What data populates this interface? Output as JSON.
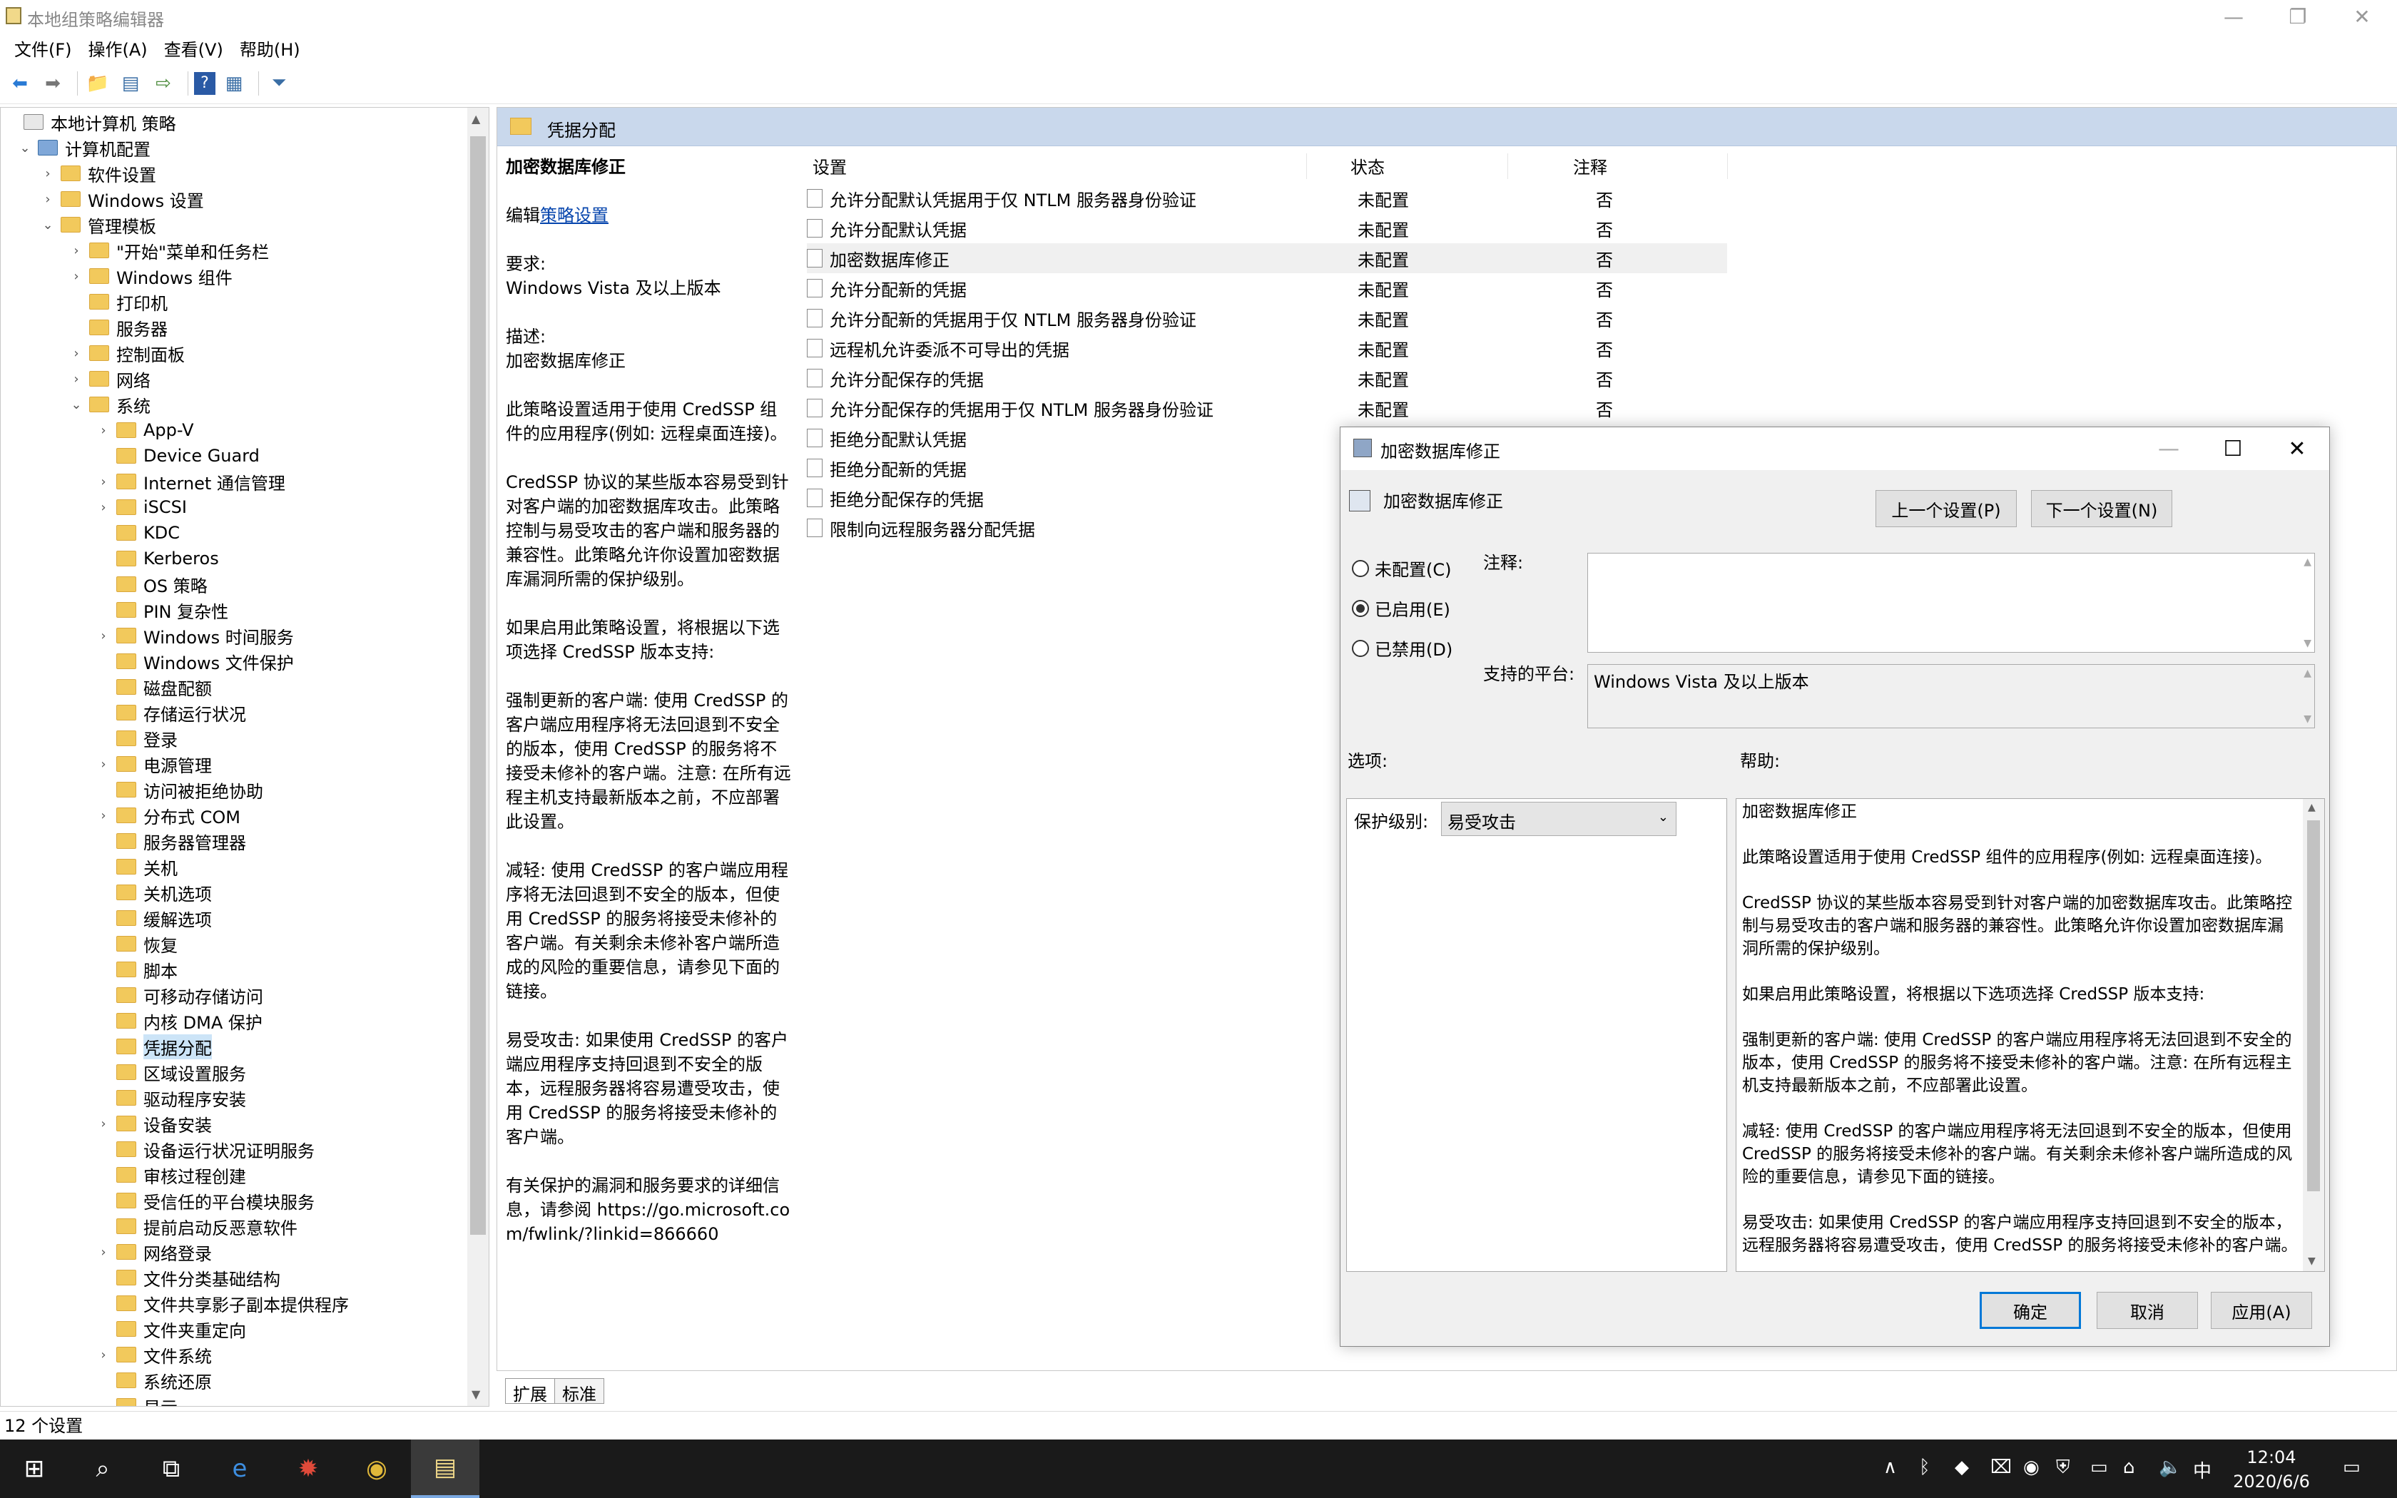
{
  "window": {
    "title": "本地组策略编辑器"
  },
  "menu": [
    "文件(F)",
    "操作(A)",
    "查看(V)",
    "帮助(H)"
  ],
  "tree": [
    {
      "label": "本地计算机 策略",
      "level": 0,
      "exp": ""
    },
    {
      "label": "计算机配置",
      "level": 1,
      "exp": "v"
    },
    {
      "label": "软件设置",
      "level": 2,
      "exp": ">"
    },
    {
      "label": "Windows 设置",
      "level": 2,
      "exp": ">"
    },
    {
      "label": "管理模板",
      "level": 2,
      "exp": "v"
    },
    {
      "label": "\"开始\"菜单和任务栏",
      "level": 3,
      "exp": ">"
    },
    {
      "label": "Windows 组件",
      "level": 3,
      "exp": ">"
    },
    {
      "label": "打印机",
      "level": 3,
      "exp": ""
    },
    {
      "label": "服务器",
      "level": 3,
      "exp": ""
    },
    {
      "label": "控制面板",
      "level": 3,
      "exp": ">"
    },
    {
      "label": "网络",
      "level": 3,
      "exp": ">"
    },
    {
      "label": "系统",
      "level": 3,
      "exp": "v"
    },
    {
      "label": "App-V",
      "level": 4,
      "exp": ">"
    },
    {
      "label": "Device Guard",
      "level": 4,
      "exp": ""
    },
    {
      "label": "Internet 通信管理",
      "level": 4,
      "exp": ">"
    },
    {
      "label": "iSCSI",
      "level": 4,
      "exp": ">"
    },
    {
      "label": "KDC",
      "level": 4,
      "exp": ""
    },
    {
      "label": "Kerberos",
      "level": 4,
      "exp": ""
    },
    {
      "label": "OS 策略",
      "level": 4,
      "exp": ""
    },
    {
      "label": "PIN 复杂性",
      "level": 4,
      "exp": ""
    },
    {
      "label": "Windows 时间服务",
      "level": 4,
      "exp": ">"
    },
    {
      "label": "Windows 文件保护",
      "level": 4,
      "exp": ""
    },
    {
      "label": "磁盘配额",
      "level": 4,
      "exp": ""
    },
    {
      "label": "存储运行状况",
      "level": 4,
      "exp": ""
    },
    {
      "label": "登录",
      "level": 4,
      "exp": ""
    },
    {
      "label": "电源管理",
      "level": 4,
      "exp": ">"
    },
    {
      "label": "访问被拒绝协助",
      "level": 4,
      "exp": ""
    },
    {
      "label": "分布式 COM",
      "level": 4,
      "exp": ">"
    },
    {
      "label": "服务器管理器",
      "level": 4,
      "exp": ""
    },
    {
      "label": "关机",
      "level": 4,
      "exp": ""
    },
    {
      "label": "关机选项",
      "level": 4,
      "exp": ""
    },
    {
      "label": "缓解选项",
      "level": 4,
      "exp": ""
    },
    {
      "label": "恢复",
      "level": 4,
      "exp": ""
    },
    {
      "label": "脚本",
      "level": 4,
      "exp": ""
    },
    {
      "label": "可移动存储访问",
      "level": 4,
      "exp": ""
    },
    {
      "label": "内核 DMA 保护",
      "level": 4,
      "exp": ""
    },
    {
      "label": "凭据分配",
      "level": 4,
      "exp": "",
      "selected": true
    },
    {
      "label": "区域设置服务",
      "level": 4,
      "exp": ""
    },
    {
      "label": "驱动程序安装",
      "level": 4,
      "exp": ""
    },
    {
      "label": "设备安装",
      "level": 4,
      "exp": ">"
    },
    {
      "label": "设备运行状况证明服务",
      "level": 4,
      "exp": ""
    },
    {
      "label": "审核过程创建",
      "level": 4,
      "exp": ""
    },
    {
      "label": "受信任的平台模块服务",
      "level": 4,
      "exp": ""
    },
    {
      "label": "提前启动反恶意软件",
      "level": 4,
      "exp": ""
    },
    {
      "label": "网络登录",
      "level": 4,
      "exp": ">"
    },
    {
      "label": "文件分类基础结构",
      "level": 4,
      "exp": ""
    },
    {
      "label": "文件共享影子副本提供程序",
      "level": 4,
      "exp": ""
    },
    {
      "label": "文件夹重定向",
      "level": 4,
      "exp": ""
    },
    {
      "label": "文件系统",
      "level": 4,
      "exp": ">"
    },
    {
      "label": "系统还原",
      "level": 4,
      "exp": ""
    },
    {
      "label": "显示",
      "level": 4,
      "exp": ""
    }
  ],
  "right": {
    "header": "凭据分配",
    "desc": {
      "title": "加密数据库修正",
      "edit_prefix": "编辑",
      "edit_link": "策略设置",
      "req_label": "要求:",
      "req_value": "Windows Vista 及以上版本",
      "desc_label": "描述:",
      "desc_value": "加密数据库修正",
      "p1": "此策略设置适用于使用 CredSSP 组件的应用程序(例如: 远程桌面连接)。",
      "p2": "CredSSP 协议的某些版本容易受到针对客户端的加密数据库攻击。此策略控制与易受攻击的客户端和服务器的兼容性。此策略允许你设置加密数据库漏洞所需的保护级别。",
      "p3": "如果启用此策略设置，将根据以下选项选择 CredSSP 版本支持:",
      "p4": "强制更新的客户端: 使用 CredSSP 的客户端应用程序将无法回退到不安全的版本，使用 CredSSP 的服务将不接受未修补的客户端。注意: 在所有远程主机支持最新版本之前，不应部署此设置。",
      "p5": "减轻: 使用 CredSSP 的客户端应用程序将无法回退到不安全的版本，但使用 CredSSP 的服务将接受未修补的客户端。有关剩余未修补客户端所造成的风险的重要信息，请参见下面的链接。",
      "p6": "易受攻击: 如果使用 CredSSP 的客户端应用程序支持回退到不安全的版本，远程服务器将容易遭受攻击，使用 CredSSP 的服务将接受未修补的客户端。",
      "p7": "有关保护的漏洞和服务要求的详细信息，请参阅 https://go.microsoft.com/fwlink/?linkid=866660"
    },
    "columns": {
      "setting": "设置",
      "state": "状态",
      "comment": "注释"
    },
    "rows": [
      {
        "name": "允许分配默认凭据用于仅 NTLM 服务器身份验证",
        "state": "未配置",
        "comment": "否"
      },
      {
        "name": "允许分配默认凭据",
        "state": "未配置",
        "comment": "否"
      },
      {
        "name": "加密数据库修正",
        "state": "未配置",
        "comment": "否",
        "selected": true
      },
      {
        "name": "允许分配新的凭据",
        "state": "未配置",
        "comment": "否"
      },
      {
        "name": "允许分配新的凭据用于仅 NTLM 服务器身份验证",
        "state": "未配置",
        "comment": "否"
      },
      {
        "name": "远程机允许委派不可导出的凭据",
        "state": "未配置",
        "comment": "否"
      },
      {
        "name": "允许分配保存的凭据",
        "state": "未配置",
        "comment": "否"
      },
      {
        "name": "允许分配保存的凭据用于仅 NTLM 服务器身份验证",
        "state": "未配置",
        "comment": "否"
      },
      {
        "name": "拒绝分配默认凭据",
        "state": "",
        "comment": ""
      },
      {
        "name": "拒绝分配新的凭据",
        "state": "",
        "comment": ""
      },
      {
        "name": "拒绝分配保存的凭据",
        "state": "",
        "comment": ""
      },
      {
        "name": "限制向远程服务器分配凭据",
        "state": "",
        "comment": ""
      }
    ],
    "tabs": [
      "扩展",
      "标准"
    ]
  },
  "status": "12 个设置",
  "dialog": {
    "title": "加密数据库修正",
    "setting_name": "加密数据库修正",
    "prev": "上一个设置(P)",
    "next": "下一个设置(N)",
    "radios": [
      "未配置(C)",
      "已启用(E)",
      "已禁用(D)"
    ],
    "selected_radio": 1,
    "comment_label": "注释:",
    "platform_label": "支持的平台:",
    "platform_value": "Windows Vista 及以上版本",
    "options_label": "选项:",
    "help_label": "帮助:",
    "protect_label": "保护级别:",
    "protect_value": "易受攻击",
    "help": {
      "h0": "加密数据库修正",
      "h1": "此策略设置适用于使用 CredSSP 组件的应用程序(例如: 远程桌面连接)。",
      "h2": "CredSSP 协议的某些版本容易受到针对客户端的加密数据库攻击。此策略控制与易受攻击的客户端和服务器的兼容性。此策略允许你设置加密数据库漏洞所需的保护级别。",
      "h3": "如果启用此策略设置，将根据以下选项选择 CredSSP 版本支持:",
      "h4": "强制更新的客户端: 使用 CredSSP 的客户端应用程序将无法回退到不安全的版本，使用 CredSSP 的服务将不接受未修补的客户端。注意: 在所有远程主机支持最新版本之前，不应部署此设置。",
      "h5": "减轻: 使用 CredSSP 的客户端应用程序将无法回退到不安全的版本，但使用 CredSSP 的服务将接受未修补的客户端。有关剩余未修补客户端所造成的风险的重要信息，请参见下面的链接。",
      "h6": "易受攻击: 如果使用 CredSSP 的客户端应用程序支持回退到不安全的版本，远程服务器将容易遭受攻击，使用 CredSSP 的服务将接受未修补的客户端。"
    },
    "ok": "确定",
    "cancel": "取消",
    "apply": "应用(A)"
  },
  "taskbar": {
    "ime": "中",
    "time": "12:04",
    "date": "2020/6/6"
  }
}
